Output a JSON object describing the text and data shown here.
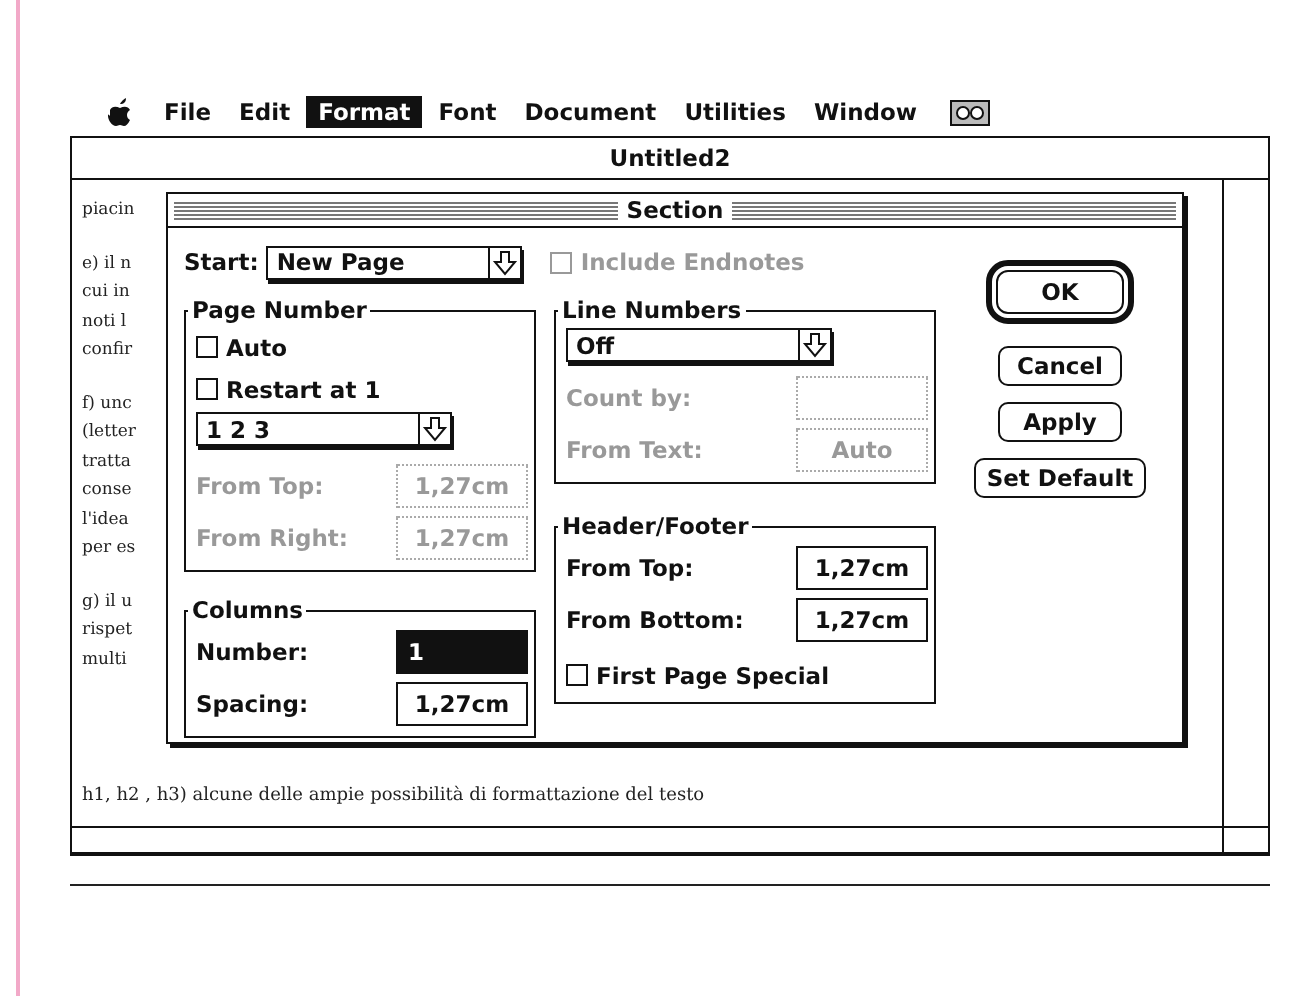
{
  "menu_bar": {
    "items": [
      {
        "label": "File",
        "selected": false
      },
      {
        "label": "Edit",
        "selected": false
      },
      {
        "label": "Format",
        "selected": true
      },
      {
        "label": "Font",
        "selected": false
      },
      {
        "label": "Document",
        "selected": false
      },
      {
        "label": "Utilities",
        "selected": false
      },
      {
        "label": "Window",
        "selected": false
      }
    ]
  },
  "window": {
    "title": "Untitled2",
    "paragraphs": [
      [
        "piacin"
      ],
      [
        "e) il n",
        "cui in",
        "noti l",
        "confir"
      ],
      [
        "f) unc",
        "(letter",
        "tratta",
        "conse",
        "l'idea",
        "per es"
      ],
      [
        "g) il u",
        "rispet",
        "multi"
      ]
    ],
    "caption": "h1, h2 , h3) alcune delle ampie possibilità di formattazione del testo"
  },
  "dialog": {
    "title": "Section",
    "start": {
      "label": "Start:",
      "value": "New Page"
    },
    "include_endnotes": {
      "label": "Include Endnotes",
      "checked": false,
      "disabled": true
    },
    "page_number": {
      "title": "Page Number",
      "checkboxes": [
        {
          "label": "Auto",
          "checked": false,
          "disabled": false
        },
        {
          "label": "Restart at 1",
          "checked": false,
          "disabled": false
        }
      ],
      "format": "1 2 3",
      "fields": [
        {
          "label": "From Top:",
          "value": "1,27cm",
          "disabled": true,
          "selected": false
        },
        {
          "label": "From Right:",
          "value": "1,27cm",
          "disabled": true,
          "selected": false
        }
      ]
    },
    "columns": {
      "title": "Columns",
      "fields": [
        {
          "label": "Number:",
          "value": "1",
          "disabled": false,
          "selected": true
        },
        {
          "label": "Spacing:",
          "value": "1,27cm",
          "disabled": false,
          "selected": false
        }
      ]
    },
    "line_numbers": {
      "title": "Line Numbers",
      "value": "Off",
      "fields": [
        {
          "label": "Count by:",
          "disabled": true,
          "selected": false
        },
        {
          "label": "From Text:",
          "value": "Auto",
          "disabled": true,
          "selected": false
        }
      ]
    },
    "header_footer": {
      "title": "Header/Footer",
      "fields": [
        {
          "label": "From Top:",
          "value": "1,27cm",
          "disabled": false,
          "selected": false
        },
        {
          "label": "From Bottom:",
          "value": "1,27cm",
          "disabled": false,
          "selected": false
        }
      ],
      "first_page_special": {
        "label": "First Page Special",
        "checked": false,
        "disabled": false
      }
    },
    "buttons": [
      {
        "label": "OK",
        "default": true
      },
      {
        "label": "Cancel",
        "default": false
      },
      {
        "label": "Apply",
        "default": false
      },
      {
        "label": "Set Default",
        "default": false
      }
    ]
  }
}
